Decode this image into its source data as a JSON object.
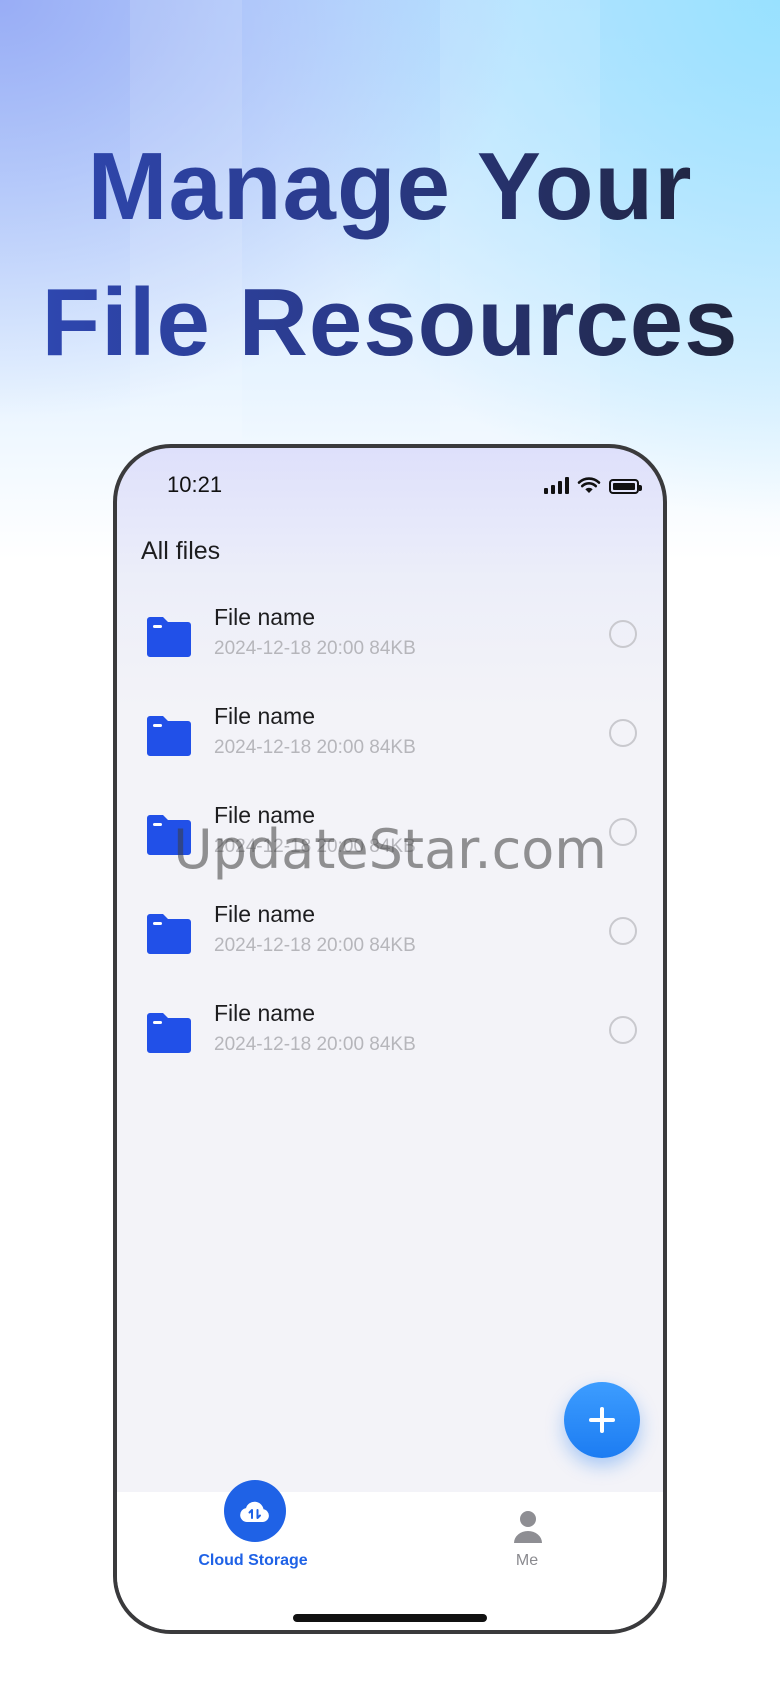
{
  "headline": {
    "line1": "Manage Your",
    "line2": "File Resources"
  },
  "status_bar": {
    "time": "10:21"
  },
  "page": {
    "title": "All files"
  },
  "files": [
    {
      "name": "File name",
      "meta": "2024-12-18 20:00 84KB"
    },
    {
      "name": "File name",
      "meta": "2024-12-18 20:00 84KB"
    },
    {
      "name": "File name",
      "meta": "2024-12-18 20:00 84KB"
    },
    {
      "name": "File name",
      "meta": "2024-12-18 20:00 84KB"
    },
    {
      "name": "File name",
      "meta": "2024-12-18 20:00 84KB"
    }
  ],
  "tabs": {
    "cloud_storage": "Cloud Storage",
    "me": "Me"
  },
  "watermark": "UpdateStar.com",
  "colors": {
    "accent": "#1f62e6",
    "folder": "#2150e8",
    "fab": "#2a8cff"
  },
  "icons": {
    "folder": "folder-icon",
    "add": "plus-icon",
    "cloud": "cloud-sync-icon",
    "me": "user-icon",
    "radio": "radio-unchecked-icon"
  }
}
